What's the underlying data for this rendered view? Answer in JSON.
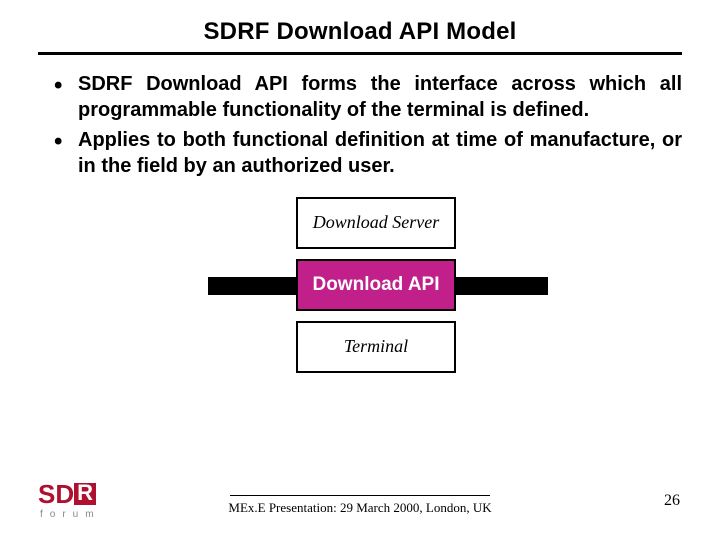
{
  "title": "SDRF Download API Model",
  "bullets": [
    "SDRF Download API forms the interface across which all programmable functionality of the terminal is defined.",
    "Applies to both functional definition at time of manufacture, or in the field by an authorized user."
  ],
  "diagram": {
    "server": "Download Server",
    "api": "Download API",
    "terminal": "Terminal"
  },
  "logo": {
    "main": "SDR",
    "sub": "forum"
  },
  "footer": {
    "text": "MEx.E Presentation: 29 March 2000, London, UK"
  },
  "page_number": "26"
}
